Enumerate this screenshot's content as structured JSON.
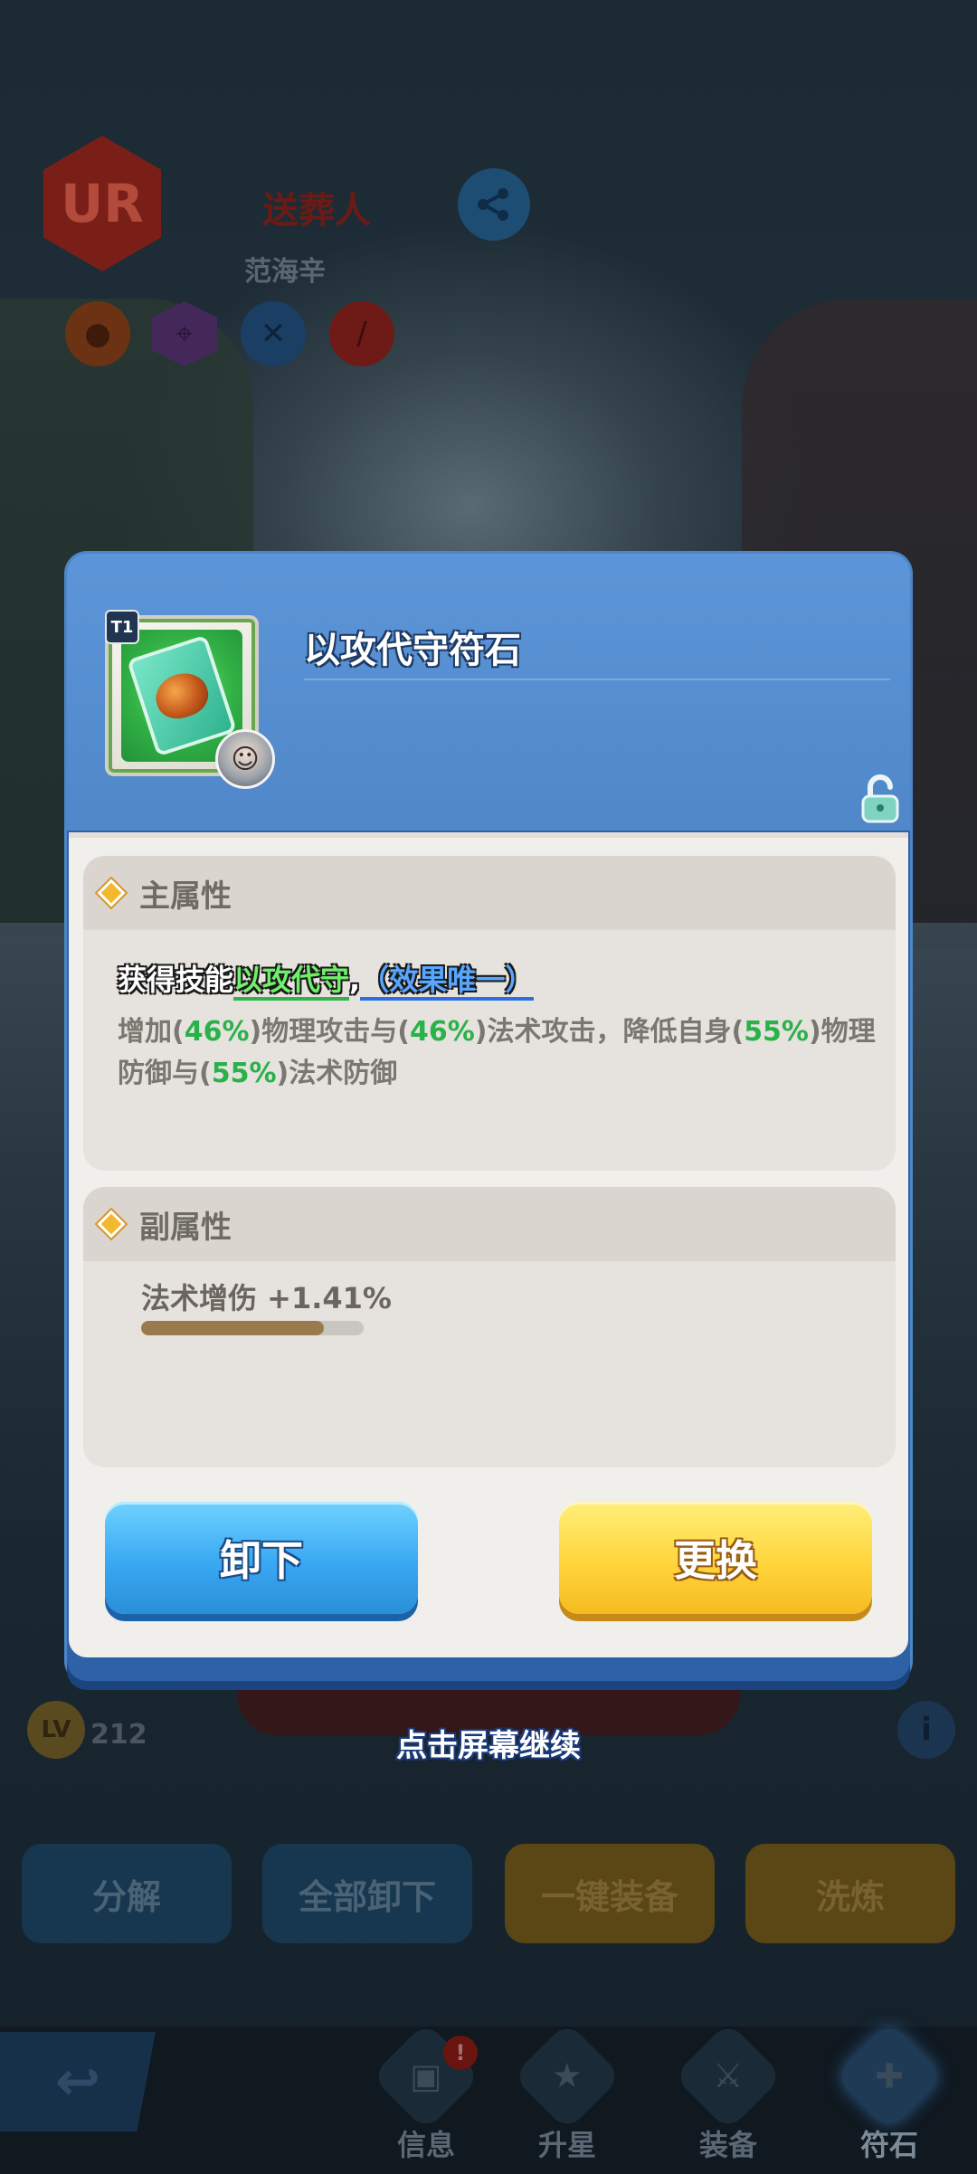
{
  "background": {
    "rarity_badge": "UR",
    "hero_name": "送葬人",
    "hero_subtitle": "范海辛",
    "trait_icons": [
      "person-icon",
      "bow-icon",
      "crossed-swords-icon",
      "sword-icon"
    ],
    "level_badge": "LV",
    "level_value": "212",
    "continue_hint": "点击屏幕继续",
    "actions": [
      "分解",
      "全部卸下",
      "一键装备",
      "洗炼"
    ],
    "nav": [
      {
        "label": "信息",
        "icon": "shirt-icon",
        "badge": "!"
      },
      {
        "label": "升星",
        "icon": "star-icon"
      },
      {
        "label": "装备",
        "icon": "sword-icon"
      },
      {
        "label": "符石",
        "icon": "rune-card-icon"
      }
    ]
  },
  "modal": {
    "tier": "T1",
    "item_name": "以攻代守符石",
    "main_attr": {
      "title": "主属性",
      "skill_prefix": "获得技能",
      "skill_name": "以攻代守",
      "skill_sep": ",",
      "skill_tag": "（效果唯一）",
      "effect": {
        "p1": "增加(",
        "v1": "46%",
        "p2": ")物理攻击与(",
        "v2": "46%",
        "p3": ")法术攻击，降低自身(",
        "v3": "55%",
        "p4": ")物理防御与(",
        "v4": "55%",
        "p5": ")法术防御"
      }
    },
    "sub_attr": {
      "title": "副属性",
      "stat_label": "法术增伤 +1.41%",
      "stat_progress": 0.82
    },
    "buttons": {
      "unequip": "卸下",
      "replace": "更换"
    }
  }
}
